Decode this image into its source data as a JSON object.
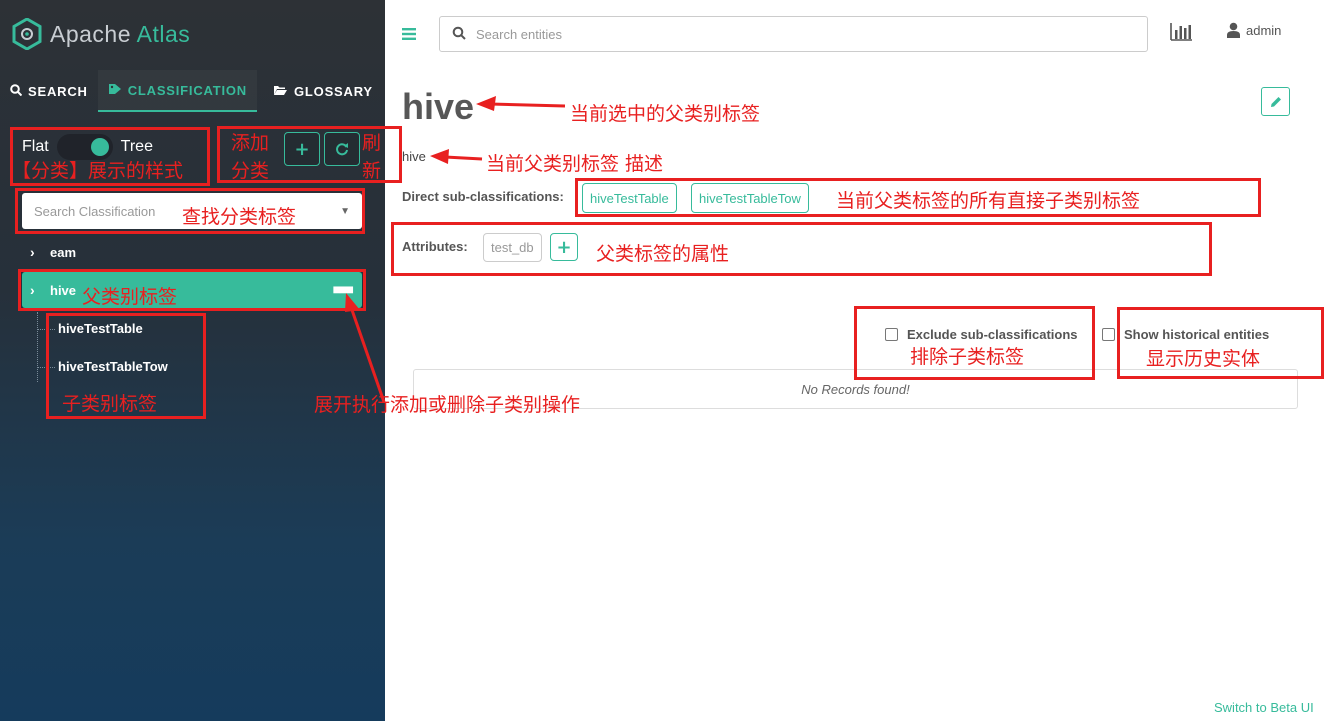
{
  "app": {
    "name_part1": "Apache",
    "name_part2": "Atlas"
  },
  "tabs": [
    {
      "label": "SEARCH",
      "icon": "search-icon"
    },
    {
      "label": "CLASSIFICATION",
      "icon": "tag-icon"
    },
    {
      "label": "GLOSSARY",
      "icon": "folder-open-icon"
    }
  ],
  "view_toggle": {
    "left": "Flat",
    "right": "Tree",
    "state": "Tree"
  },
  "classification_search": {
    "placeholder": "Search Classification"
  },
  "tree": {
    "items": [
      {
        "label": "eam"
      },
      {
        "label": "hive"
      }
    ],
    "children": [
      {
        "label": "hiveTestTable"
      },
      {
        "label": "hiveTestTableTow"
      }
    ]
  },
  "topbar": {
    "search_placeholder": "Search entities",
    "user": "admin"
  },
  "detail": {
    "title": "hive",
    "description": "hive",
    "sub_label": "Direct sub-classifications:",
    "sub_classifications": [
      "hiveTestTable",
      "hiveTestTableTow"
    ],
    "attributes_label": "Attributes:",
    "attributes": [
      "test_db"
    ],
    "exclude_label": "Exclude sub-classifications",
    "historical_label": "Show historical entities",
    "no_records": "No Records found!"
  },
  "footer": {
    "beta_link": "Switch to Beta UI"
  },
  "annotations": {
    "toggle_style": "【分类】展示的样式",
    "add_1": "添加",
    "add_2": "分类",
    "refresh_1": "刷",
    "refresh_2": "新",
    "search_cls": "查找分类标签",
    "parent_label": "父类别标签",
    "child_label": "子类别标签",
    "dots_action": "展开执行添加或删除子类别操作",
    "selected_parent": "当前选中的父类别标签",
    "parent_desc": "当前父类别标签 描述",
    "direct_children": "当前父类标签的所有直接子类别标签",
    "attributes": "父类标签的属性",
    "exclude": "排除子类标签",
    "historical": "显示历史实体"
  },
  "colors": {
    "accent": "#37bb9b",
    "annotation": "#e82020",
    "sidebar_bg": "#26303a"
  }
}
